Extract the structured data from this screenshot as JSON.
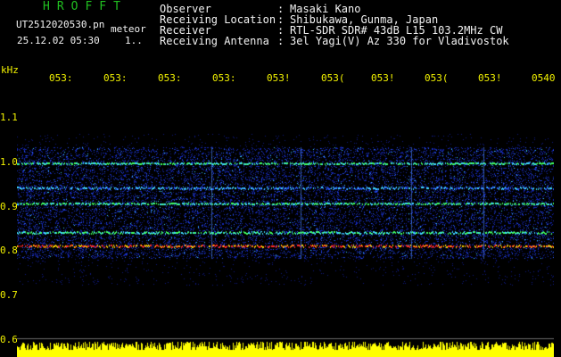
{
  "header": {
    "brand": "HROFFT",
    "filename": "UT2512020530.pn",
    "tag": "meteor",
    "datetime": "25.12.02 05:30",
    "ellipsis": "1..",
    "meta": [
      {
        "label": "Observer",
        "value": "Masaki Kano"
      },
      {
        "label": "Receiving Location",
        "value": "Shibukawa, Gunma, Japan"
      },
      {
        "label": "Receiver",
        "value": "RTL-SDR SDR# 43dB L15 103.2MHz CW"
      },
      {
        "label": "Receiving Antenna",
        "value": "3el Yagi(V) Az 330 for Vladivostok"
      }
    ]
  },
  "colors": {
    "background": "#000000",
    "header_green": "#21c021",
    "text_white": "#f2f2f2",
    "tick_yellow": "#f2f200",
    "noise_blue": "#1a3cff",
    "echo_red": "#ff2020"
  },
  "chart_data": {
    "type": "heatmap",
    "y_unit": "kHz",
    "x_ticks": [
      "053",
      "053",
      "053",
      "053",
      "053",
      "053",
      "053",
      "053",
      "053",
      "0540"
    ],
    "x_tick_labels_partial": [
      "053:",
      "053:",
      "053:",
      "053:",
      "053!",
      "053(",
      "053!",
      "053(",
      "053!",
      "0540"
    ],
    "y_ticks": [
      "1.1",
      "1.0",
      "0.9",
      "0.8",
      "0.7",
      "0.6"
    ],
    "ylim": [
      0.6,
      1.15
    ],
    "bands_khz": [
      {
        "f": 0.995,
        "level": "green"
      },
      {
        "f": 0.94,
        "level": "cyan"
      },
      {
        "f": 0.905,
        "level": "green"
      },
      {
        "f": 0.84,
        "level": "green"
      },
      {
        "f": 0.81,
        "level": "red"
      }
    ],
    "bottom_strip": "yellow activity bar"
  }
}
